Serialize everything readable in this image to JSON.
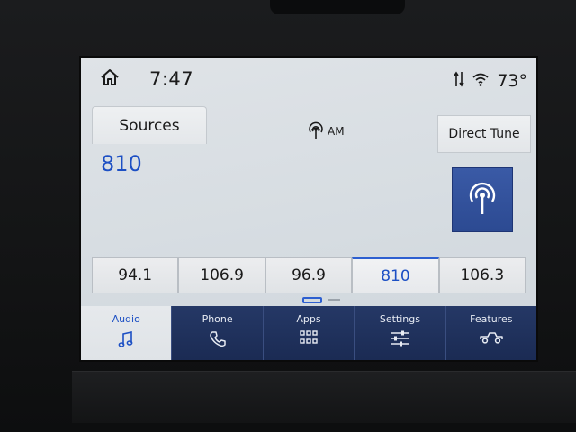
{
  "status": {
    "time": "7:47",
    "temperature": "73°"
  },
  "source": {
    "sources_label": "Sources",
    "band_label": "AM",
    "direct_tune_label": "Direct Tune",
    "current_station": "810"
  },
  "presets": [
    {
      "label": "94.1",
      "active": false
    },
    {
      "label": "106.9",
      "active": false
    },
    {
      "label": "96.9",
      "active": false
    },
    {
      "label": "810",
      "active": true
    },
    {
      "label": "106.3",
      "active": false
    }
  ],
  "nav": {
    "audio": "Audio",
    "phone": "Phone",
    "apps": "Apps",
    "settings": "Settings",
    "features": "Features"
  },
  "colors": {
    "accent": "#1c4fc4",
    "nav_bg": "#1a2a52",
    "screen_bg": "#d7dde2"
  },
  "icons": {
    "home": "home-icon",
    "wifi": "wifi-icon",
    "broadcast": "broadcast-icon",
    "music": "music-note-icon",
    "phone": "phone-icon",
    "apps": "apps-grid-icon",
    "settings": "sliders-icon",
    "features": "truck-icon"
  }
}
